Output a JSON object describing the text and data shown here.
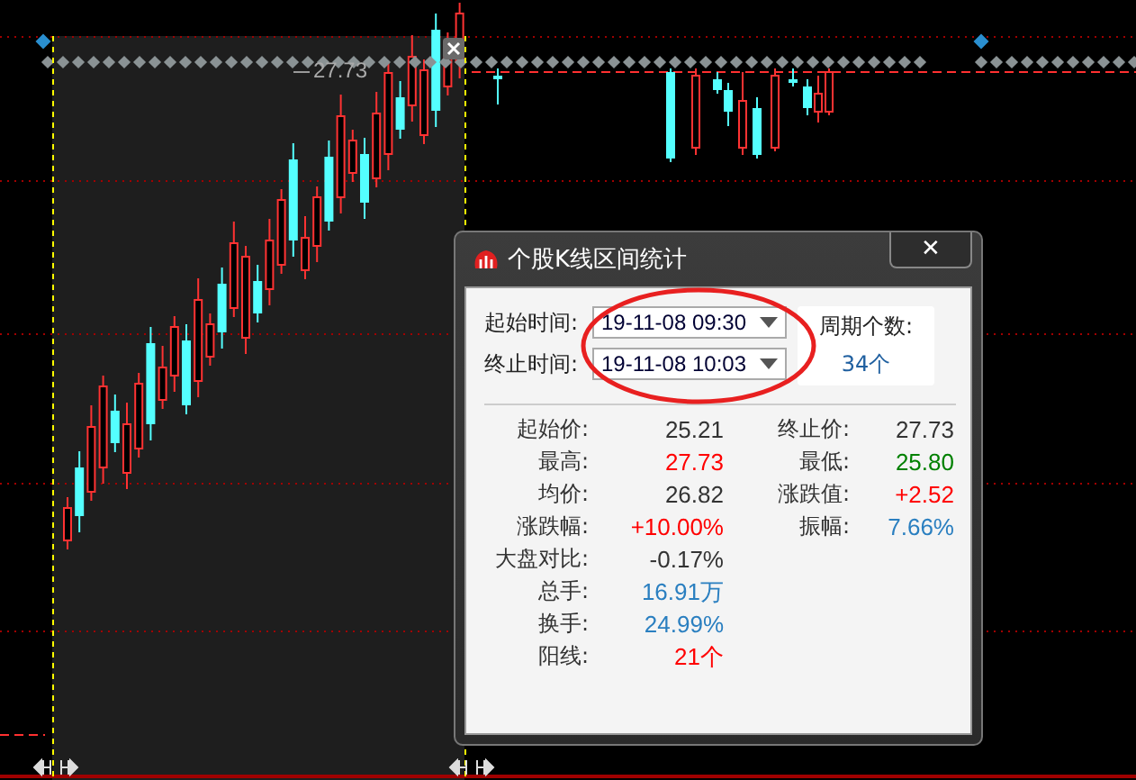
{
  "chart": {
    "high_label": "27.73"
  },
  "dialog": {
    "title": "个股K线区间统计",
    "close": "✕",
    "start": {
      "label": "起始时间:",
      "value": "19-11-08 09:30"
    },
    "end": {
      "label": "终止时间:",
      "value": "19-11-08 10:03"
    },
    "period": {
      "label": "周期个数:",
      "value": "34个"
    },
    "stats": [
      {
        "left": {
          "label": "起始价:",
          "value": "25.21",
          "color": "#333333"
        },
        "right": {
          "label": "终止价:",
          "value": "27.73",
          "color": "#333333"
        }
      },
      {
        "left": {
          "label": "最高:",
          "value": "27.73",
          "color": "#ff0000"
        },
        "right": {
          "label": "最低:",
          "value": "25.80",
          "color": "#008000"
        }
      },
      {
        "left": {
          "label": "均价:",
          "value": "26.82",
          "color": "#333333"
        },
        "right": {
          "label": "涨跌值:",
          "value": "+2.52",
          "color": "#ff0000"
        }
      },
      {
        "left": {
          "label": "涨跌幅:",
          "value": "+10.00%",
          "color": "#ff0000"
        },
        "right": {
          "label": "振幅:",
          "value": "7.66%",
          "color": "#2a7fc0"
        }
      },
      {
        "left": {
          "label": "大盘对比:",
          "value": "-0.17%",
          "color": "#333333"
        }
      },
      {
        "left": {
          "label": "总手:",
          "value": "16.91万",
          "color": "#2a7fc0"
        }
      },
      {
        "left": {
          "label": "换手:",
          "value": "24.99%",
          "color": "#2a7fc0"
        }
      },
      {
        "left": {
          "label": "阳线:",
          "value": "21个",
          "color": "#ff0000"
        }
      }
    ]
  }
}
